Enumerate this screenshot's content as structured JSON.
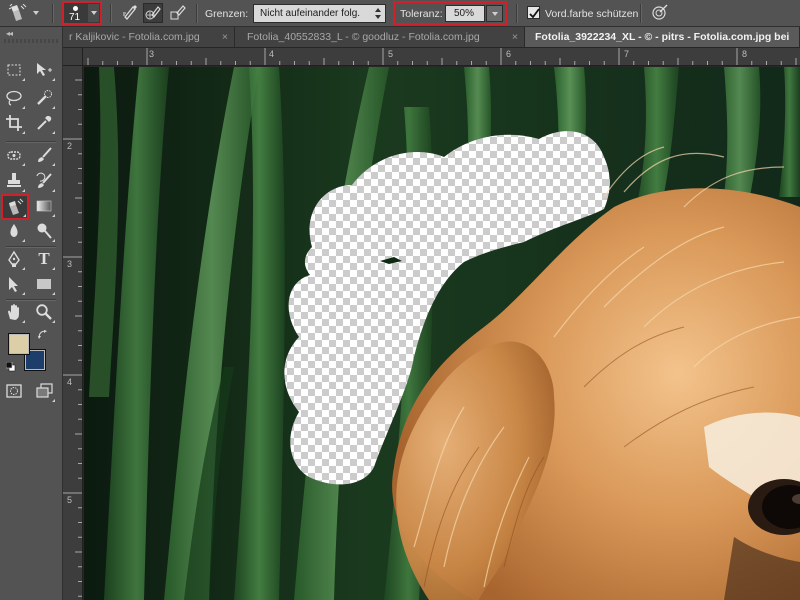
{
  "options_bar": {
    "tool_icon": "background-eraser-icon",
    "brush_size": "71",
    "sampling_modes": [
      "sampling-continuous-icon",
      "sampling-once-icon",
      "sampling-background-swatch-icon"
    ],
    "limits_label": "Grenzen:",
    "limits_value": "Nicht aufeinander folg.",
    "tolerance_label": "Toleranz:",
    "tolerance_value": "50%",
    "protect_fg_label": "Vord.farbe schützen",
    "protect_fg_checked": true,
    "pressure_icon": "pen-pressure-icon",
    "highlight_color": "#d0202a"
  },
  "tabs": [
    {
      "label": "r Kaljikovic - Fotolia.com.jpg",
      "active": false
    },
    {
      "label": "Fotolia_40552833_L - © goodluz - Fotolia.com.jpg",
      "active": false
    },
    {
      "label": "Fotolia_3922234_XL - © - pitrs - Fotolia.com.jpg bei",
      "active": true
    }
  ],
  "tab_close": "×",
  "ruler_top": [
    "3",
    "4",
    "5",
    "6",
    "7",
    "8"
  ],
  "ruler_left": [
    "2",
    "3",
    "4",
    "5"
  ],
  "toolbox": {
    "collapse": "◂◂",
    "tools": [
      "rectangular-marquee-icon",
      "move-icon",
      "lasso-icon",
      "quick-selection-icon",
      "crop-icon",
      "eyedropper-icon",
      "spot-healing-icon",
      "brush-icon",
      "clone-stamp-icon",
      "history-brush-icon",
      "background-eraser-icon",
      "gradient-icon",
      "blur-icon",
      "dodge-icon",
      "pen-icon",
      "type-icon",
      "path-selection-icon",
      "rectangle-shape-icon",
      "hand-icon",
      "zoom-icon"
    ],
    "active_tool": "background-eraser-icon",
    "foreground_color": "#dccfa8",
    "background_color": "#1d3d6a",
    "quick_mask_icon": "quick-mask-icon",
    "screen_mode_icon": "screen-mode-icon",
    "type_glyph": "T"
  }
}
